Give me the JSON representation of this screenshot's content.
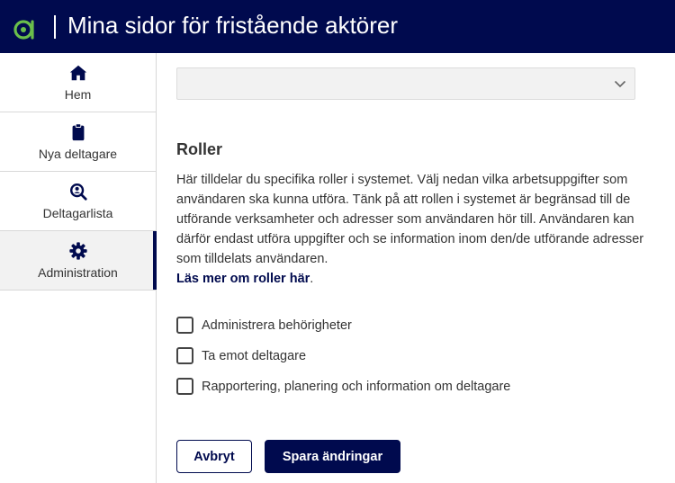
{
  "header": {
    "title": "Mina sidor för fristående aktörer",
    "background": "#000a4e",
    "logo_color": "#6abf4b"
  },
  "sidebar": {
    "items": [
      {
        "label": "Hem",
        "icon": "home-icon",
        "active": false
      },
      {
        "label": "Nya deltagare",
        "icon": "clipboard-icon",
        "active": false
      },
      {
        "label": "Deltagarlista",
        "icon": "search-person-icon",
        "active": false
      },
      {
        "label": "Administration",
        "icon": "gear-icon",
        "active": true
      }
    ]
  },
  "main": {
    "select": {
      "value": "",
      "icon": "chevron-down-icon"
    },
    "roles": {
      "title": "Roller",
      "description": "Här tilldelar du specifika roller i systemet. Välj nedan vilka arbetsuppgifter som användaren ska kunna utföra. Tänk på att rollen i systemet är begränsad till de utförande verksamheter och adresser som användaren hör till. Användaren kan därför endast utföra uppgifter och se information inom den/de utförande adresser som tilldelats användaren.",
      "read_more": "Läs mer om roller här",
      "read_more_suffix": ".",
      "options": [
        {
          "label": "Administrera behörigheter",
          "checked": false
        },
        {
          "label": "Ta emot deltagare",
          "checked": false
        },
        {
          "label": "Rapportering, planering och information om deltagare",
          "checked": false
        }
      ]
    },
    "buttons": {
      "cancel": "Avbryt",
      "save": "Spara ändringar"
    }
  },
  "colors": {
    "accent": "#000a4e",
    "text": "#333333"
  }
}
